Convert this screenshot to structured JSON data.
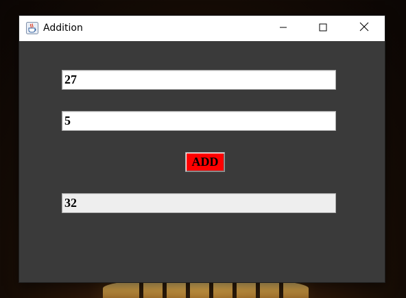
{
  "window": {
    "title": "Addition",
    "icon": "java-cup-icon"
  },
  "title_bar_buttons": {
    "minimize_icon": "minimize-icon",
    "maximize_icon": "maximize-icon",
    "close_icon": "close-icon"
  },
  "form": {
    "first_number": "27",
    "second_number": "5",
    "add_label": "ADD",
    "result": "32"
  },
  "colors": {
    "window_background": "#3a3a3a",
    "add_button_background": "#ff0000",
    "result_field_background": "#eeeeee",
    "input_field_background": "#ffffff"
  }
}
